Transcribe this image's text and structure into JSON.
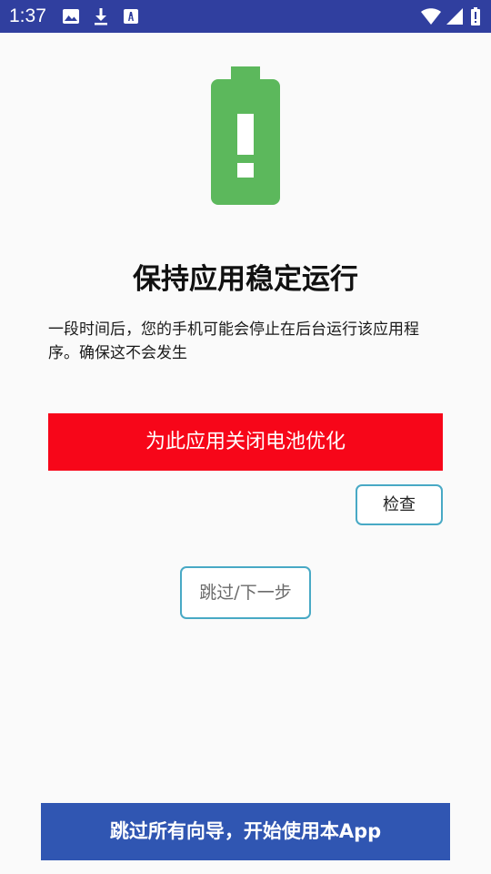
{
  "status_bar": {
    "time": "1:37",
    "icons": [
      "image-icon",
      "download-icon",
      "font-a-icon",
      "wifi-icon",
      "cell-signal-icon",
      "battery-alert-icon"
    ]
  },
  "illustration": {
    "icon": "battery-alert-icon",
    "color": "#5cb85c"
  },
  "main": {
    "title": "保持应用稳定运行",
    "description": "一段时间后，您的手机可能会停止在后台运行该应用程序。确保这不会发生",
    "primary_button_label": "为此应用关闭电池优化",
    "check_button_label": "检查",
    "skip_next_label": "跳过/下一步"
  },
  "footer": {
    "skip_all_label": "跳过所有向导，开始使用本App"
  },
  "colors": {
    "status_bar": "#303f9f",
    "primary_button": "#f70619",
    "outline_button_border": "#48a9c5",
    "footer_button": "#3056b2",
    "battery_green": "#5cb85c"
  }
}
